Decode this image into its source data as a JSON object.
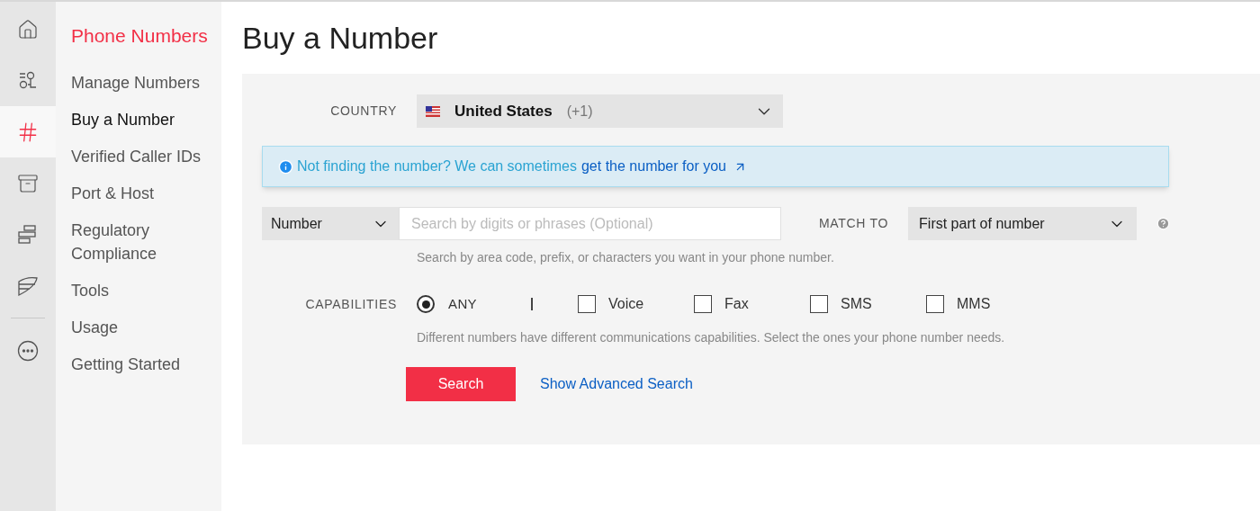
{
  "rail": [
    {
      "kind": "home",
      "selected": false
    },
    {
      "kind": "nodes",
      "selected": false
    },
    {
      "kind": "hash",
      "selected": true
    },
    {
      "kind": "archive",
      "selected": false
    },
    {
      "kind": "blocks",
      "selected": false
    },
    {
      "kind": "wing",
      "selected": false
    },
    {
      "kind": "more",
      "selected": false
    }
  ],
  "sidebar": {
    "title": "Phone Numbers",
    "items": [
      {
        "label": "Manage Numbers",
        "selected": false
      },
      {
        "label": "Buy a Number",
        "selected": true
      },
      {
        "label": "Verified Caller IDs",
        "selected": false
      },
      {
        "label": "Port & Host",
        "selected": false
      },
      {
        "label": "Regulatory Compliance",
        "selected": false
      },
      {
        "label": "Tools",
        "selected": false
      },
      {
        "label": "Usage",
        "selected": false
      },
      {
        "label": "Getting Started",
        "selected": false
      }
    ]
  },
  "title": "Buy a Number",
  "country": {
    "label": "COUNTRY",
    "name": "United States",
    "code": "(+1)"
  },
  "banner": {
    "text": "Not finding the number? We can sometimes",
    "link": "get the number for you"
  },
  "search": {
    "type": "Number",
    "placeholder": "Search by digits or phrases (Optional)",
    "match_label": "MATCH TO",
    "match": "First part of number",
    "hint": "Search by area code, prefix, or characters you want in your phone number."
  },
  "capabilities": {
    "label": "CAPABILITIES",
    "options": [
      {
        "kind": "radio",
        "label": "ANY",
        "checked": true
      },
      {
        "kind": "divider"
      },
      {
        "kind": "checkbox",
        "label": "Voice",
        "checked": false
      },
      {
        "kind": "checkbox",
        "label": "Fax",
        "checked": false
      },
      {
        "kind": "checkbox",
        "label": "SMS",
        "checked": false
      },
      {
        "kind": "checkbox",
        "label": "MMS",
        "checked": false
      }
    ],
    "hint": "Different numbers have different communications capabilities. Select the ones your phone number needs."
  },
  "buttons": {
    "search": "Search",
    "advanced": "Show Advanced Search"
  }
}
